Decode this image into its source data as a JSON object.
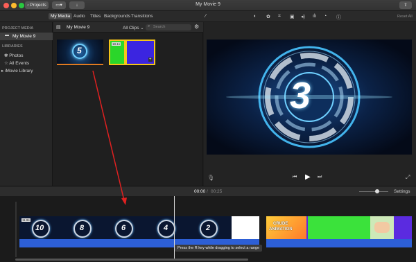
{
  "window": {
    "title": "My Movie 9",
    "back_button": "Projects"
  },
  "tabs": [
    {
      "label": "My Media",
      "active": true
    },
    {
      "label": "Audio",
      "active": false
    },
    {
      "label": "Titles",
      "active": false
    },
    {
      "label": "Backgrounds",
      "active": false
    },
    {
      "label": "Transitions",
      "active": false
    }
  ],
  "viewer_toolbar": {
    "reset_all": "Reset All",
    "icons": [
      "magic-wand",
      "color-balance",
      "color-correction",
      "crop",
      "stabilization",
      "volume",
      "noise-reduction",
      "speed",
      "info"
    ]
  },
  "sidebar": {
    "project_media_heading": "PROJECT MEDIA",
    "project_item": "My Movie 9",
    "libraries_heading": "LIBRARIES",
    "items": [
      {
        "label": "Photos",
        "icon": "photos-icon"
      },
      {
        "label": "All Events",
        "icon": "star-icon"
      },
      {
        "label": "iMovie Library",
        "icon": "disclosure-icon"
      }
    ]
  },
  "browser": {
    "title": "My Movie 9",
    "filter": "All Clips",
    "search_placeholder": "Search",
    "clips": [
      {
        "name": "countdown-clip",
        "badge": "5",
        "selected": false
      },
      {
        "name": "green-screen-clip",
        "badge": "18.1s",
        "selected": true
      }
    ]
  },
  "viewer": {
    "countdown_number": "3"
  },
  "timeline": {
    "current_time": "00:00",
    "separator": "/",
    "total_time": "00:25",
    "settings_label": "Settings",
    "clip_badge": "11.9s",
    "countdown_numbers": [
      "10",
      "8",
      "6",
      "4",
      "2"
    ],
    "thumb_text": [
      "CRUDE",
      "ANIMATION"
    ],
    "tooltip": "Press the R key while dragging to select a range"
  },
  "colors": {
    "accent_blue": "#2d5fd6",
    "green_screen": "#3be23b",
    "purple": "#5b2be0",
    "selection_yellow": "#f5c518",
    "annotation_red": "#e02020"
  }
}
